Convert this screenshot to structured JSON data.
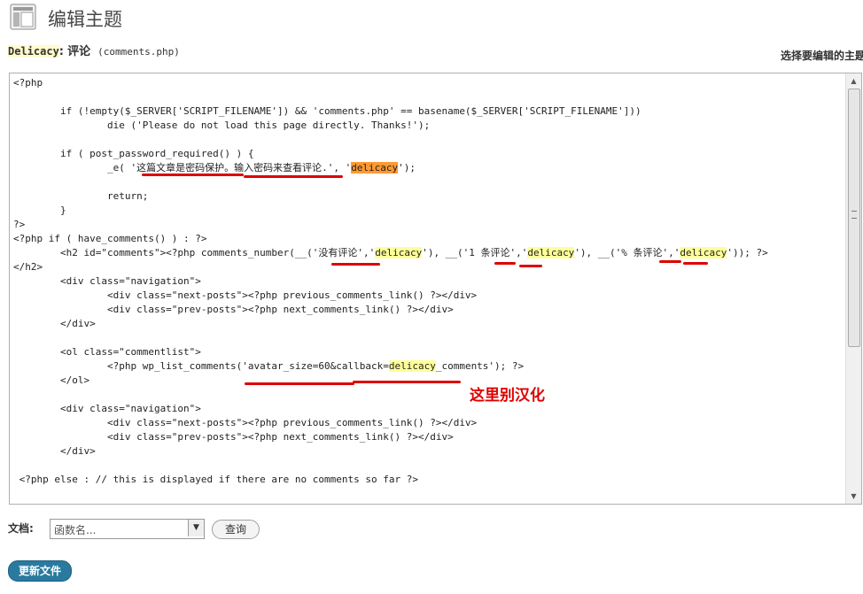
{
  "page": {
    "title": "编辑主题"
  },
  "file": {
    "theme": "Delicacy",
    "colon": ":",
    "title": "评论",
    "filename": "(comments.php)"
  },
  "selector": {
    "label": "选择要编辑的主题"
  },
  "code": {
    "l1": "<?php",
    "l2": "",
    "l3": "        if (!empty($_SERVER['SCRIPT_FILENAME']) && 'comments.php' == basename($_SERVER['SCRIPT_FILENAME']))",
    "l4": "                die ('Please do not load this page directly. Thanks!');",
    "l5": "",
    "l6": "        if ( post_password_required() ) {",
    "l7a": "                _e( '这篇文章是密码保护。输入密码来查看评论.', '",
    "l7b": "delicacy",
    "l7c": "');",
    "l8": "",
    "l9": "                return;",
    "l10": "        }",
    "l11": "?>",
    "l12": "<?php if ( have_comments() ) : ?>",
    "l13a": "        <h2 id=\"comments\"><?php comments_number(__('没有评论','",
    "l13b": "delicacy",
    "l13c": "'), __('1 条评论','",
    "l13d": "delicacy",
    "l13e": "'), __('% 条评论','",
    "l13f": "delicacy",
    "l13g": "')); ?>",
    "l14": "</h2>",
    "l15": "        <div class=\"navigation\">",
    "l16": "                <div class=\"next-posts\"><?php previous_comments_link() ?></div>",
    "l17": "                <div class=\"prev-posts\"><?php next_comments_link() ?></div>",
    "l18": "        </div>",
    "l19": "",
    "l20": "        <ol class=\"commentlist\">",
    "l21a": "                <?php wp_list_comments('avatar_size=60&callback=",
    "l21b": "delicacy",
    "l21c": "_comments'); ?>",
    "l22": "        </ol>",
    "l23": "",
    "l24": "        <div class=\"navigation\">",
    "l25": "                <div class=\"next-posts\"><?php previous_comments_link() ?></div>",
    "l26": "                <div class=\"prev-posts\"><?php next_comments_link() ?></div>",
    "l27": "        </div>",
    "l28": "",
    "l29": " <?php else : // this is displayed if there are no comments so far ?>"
  },
  "annotation": {
    "text": "这里别汉化",
    "color": "#dd0000"
  },
  "docs": {
    "label": "文档:",
    "select_value": "函数名...",
    "lookup_button": "查询"
  },
  "actions": {
    "update_button": "更新文件"
  },
  "colors": {
    "highlight": "#ffff99",
    "highlight_active": "#ff9933",
    "button_primary": "#2a7a9f"
  },
  "icons": {
    "page": "page-layout-icon",
    "scroll_up": "arrow-up-icon",
    "scroll_down": "arrow-down-icon",
    "dropdown": "chevron-down-icon"
  }
}
